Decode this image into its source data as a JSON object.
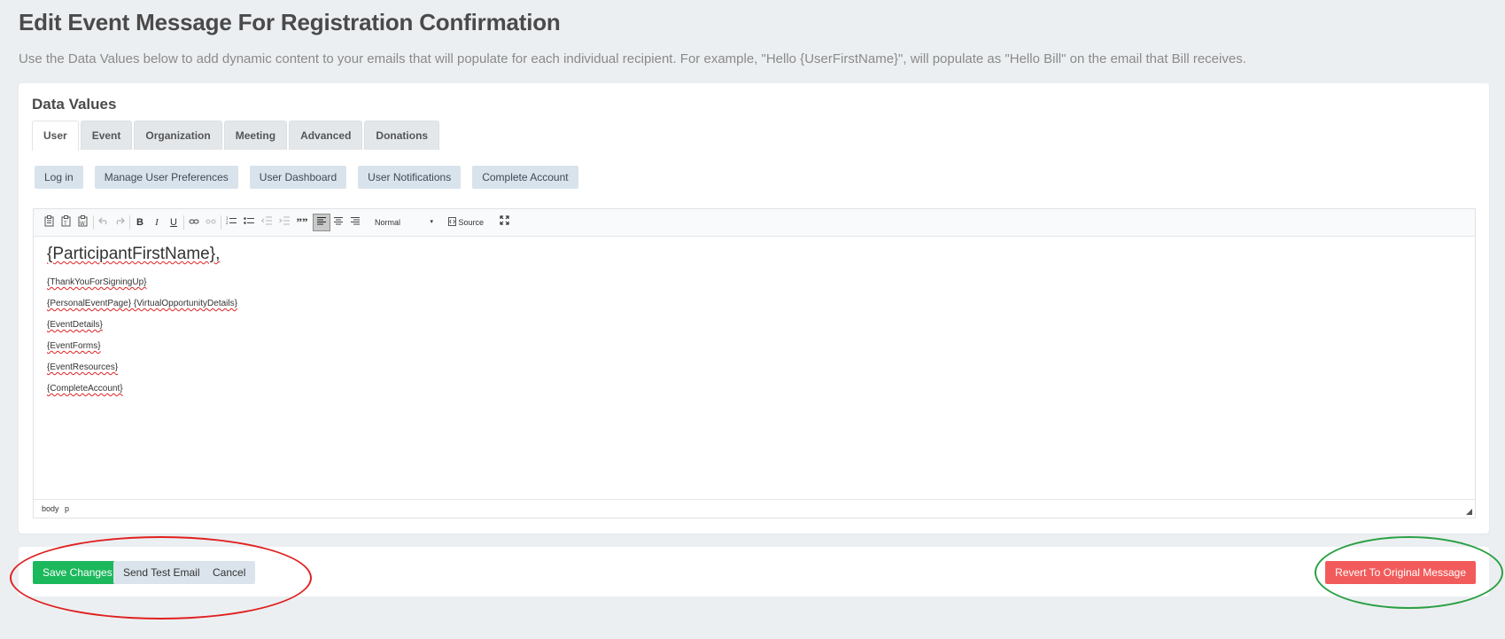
{
  "header": {
    "title": "Edit Event Message For Registration Confirmation",
    "subtitle": "Use the Data Values below to add dynamic content to your emails that will populate for each individual recipient. For example, \"Hello {UserFirstName}\", will populate as \"Hello Bill\" on the email that Bill receives."
  },
  "data_values": {
    "title": "Data Values",
    "tabs": [
      "User",
      "Event",
      "Organization",
      "Meeting",
      "Advanced",
      "Donations"
    ],
    "active_tab": "User",
    "buttons": [
      "Log in",
      "Manage User Preferences",
      "User Dashboard",
      "User Notifications",
      "Complete Account"
    ]
  },
  "editor": {
    "toolbar": {
      "format": "Normal",
      "source_label": "Source",
      "icons": [
        "paste-icon",
        "paste-text-icon",
        "paste-word-icon",
        "undo-icon",
        "redo-icon",
        "bold-icon",
        "italic-icon",
        "underline-icon",
        "link-icon",
        "unlink-icon",
        "numbered-list-icon",
        "bulleted-list-icon",
        "outdent-icon",
        "indent-icon",
        "blockquote-icon",
        "align-left-icon",
        "align-center-icon",
        "align-right-icon",
        "source-icon",
        "maximize-icon"
      ],
      "bold": "B",
      "italic": "I",
      "underline": "U",
      "blockquote": "””"
    },
    "greeting": "{ParticipantFirstName},",
    "lines": [
      "{ThankYouForSigningUp}",
      "{PersonalEventPage} {VirtualOpportunityDetails}",
      "{EventDetails}",
      "{EventForms}",
      "{EventResources}",
      "{CompleteAccount}"
    ],
    "status_path": [
      "body",
      "p"
    ]
  },
  "actions": {
    "save": "Save Changes",
    "test": "Send Test Email",
    "cancel": "Cancel",
    "revert": "Revert To Original Message"
  },
  "colors": {
    "save": "#1cb85c",
    "revert": "#f25b5b",
    "annotation_red": "#e02020",
    "annotation_green": "#2aa043"
  }
}
